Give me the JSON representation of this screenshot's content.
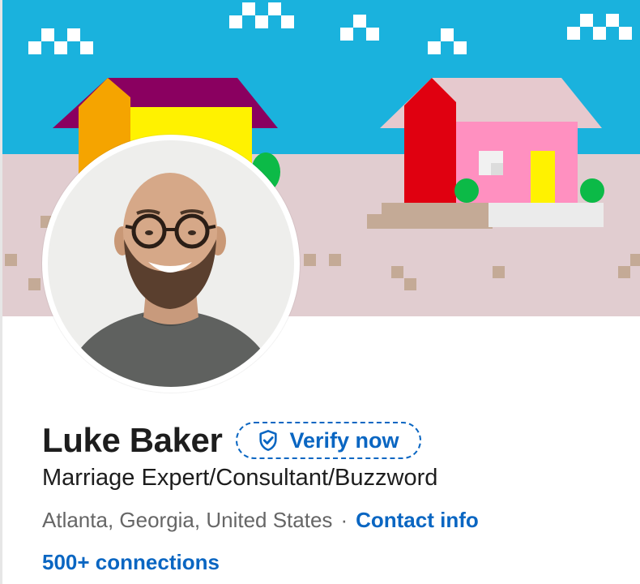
{
  "profile": {
    "name": "Luke Baker",
    "verify_label": "Verify now",
    "headline": "Marriage Expert/Consultant/Buzzword",
    "location": "Atlanta, Georgia, United States",
    "separator": "·",
    "contact_label": "Contact info",
    "connections_label": "500+ connections"
  },
  "icons": {
    "verify": "shield-check-icon"
  },
  "colors": {
    "link_blue": "#0a66c2",
    "text_primary": "#1d1d1d",
    "text_secondary": "#666666",
    "banner_sky": "#1ab2dd",
    "banner_ground": "#e1cdd0"
  }
}
